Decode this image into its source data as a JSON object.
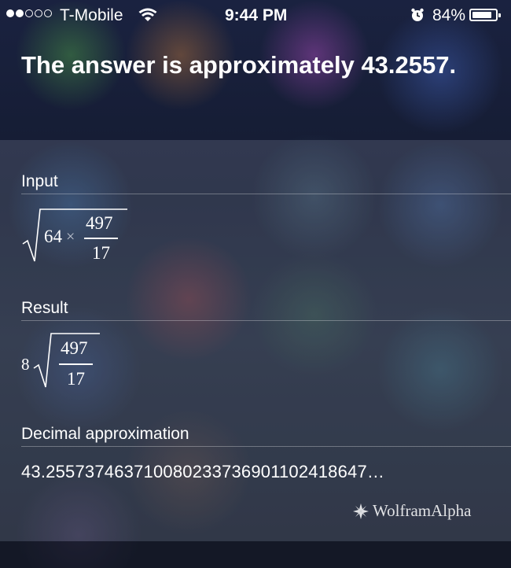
{
  "status_bar": {
    "carrier": "T-Mobile",
    "time": "9:44 PM",
    "battery": "84%",
    "signal_bars_filled": 2,
    "signal_bars_total": 5,
    "battery_level": 0.84
  },
  "siri": {
    "answer": "The answer is approximately 43.2557."
  },
  "pods": {
    "input": {
      "title": "Input",
      "radicand_factor": "64",
      "times": "×",
      "numerator": "497",
      "denominator": "17"
    },
    "result": {
      "title": "Result",
      "coefficient": "8",
      "numerator": "497",
      "denominator": "17"
    },
    "decimal": {
      "title": "Decimal approximation",
      "value": "43.2557374637100802337369011024186 47…"
    }
  },
  "branding": {
    "text": "WolframAlpha",
    "icon": "wolfram-spikey-icon"
  },
  "colors": {
    "text": "#ffffff"
  }
}
